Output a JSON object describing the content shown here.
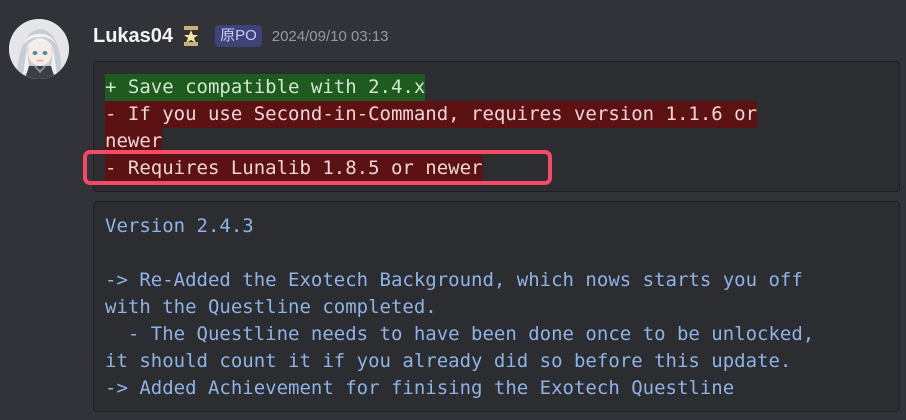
{
  "message": {
    "username": "Lukas04",
    "op_badge": "原PO",
    "timestamp": "2024/09/10 03:13",
    "rank_icon": "rank-emblem-icon",
    "avatar": "user-avatar"
  },
  "diff_block": {
    "lines": [
      {
        "type": "added",
        "text": "+ Save compatible with 2.4.x"
      },
      {
        "type": "removed",
        "text": "- If you use Second-in-Command, requires version 1.1.6 or"
      },
      {
        "type": "removed",
        "text": "newer"
      },
      {
        "type": "removed",
        "text": "- Requires Lunalib 1.8.5 or newer"
      }
    ]
  },
  "notes_block": {
    "lines": [
      "Version 2.4.3",
      "",
      "-> Re-Added the Exotech Background, which nows starts you off",
      "with the Questline completed.",
      "  - The Questline needs to have been done once to be unlocked,",
      "it should count it if you already did so before this update.",
      "-> Added Achievement for finising the Exotech Questline"
    ]
  },
  "colors": {
    "background": "#313338",
    "code_bg": "#2b2d31",
    "added_highlight": "#1f5a1f",
    "removed_highlight": "#5c1212",
    "annotation_box": "#f44a66",
    "notes_text": "#8fb3e6"
  }
}
